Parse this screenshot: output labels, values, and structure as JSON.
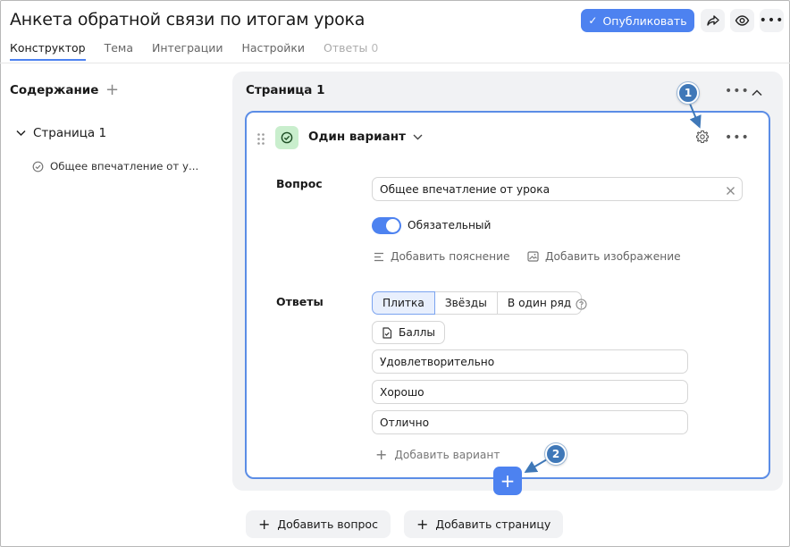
{
  "header": {
    "title": "Анкета обратной связи по итогам урока",
    "publish_label": "Опубликовать",
    "share_icon": "share-icon",
    "preview_icon": "eye-icon",
    "more_icon": "more-icon"
  },
  "tabs": [
    {
      "label": "Конструктор",
      "active": true
    },
    {
      "label": "Тема"
    },
    {
      "label": "Интеграции"
    },
    {
      "label": "Настройки"
    },
    {
      "label": "Ответы",
      "count": "0",
      "disabled": true
    }
  ],
  "sidebar": {
    "title": "Содержание",
    "page_label": "Страница 1",
    "question_label": "Общее впечатление от у..."
  },
  "page": {
    "title": "Страница 1"
  },
  "question": {
    "type_label": "Один вариант",
    "question_label": "Вопрос",
    "question_value": "Общее впечатление от урока",
    "required_label": "Обязательный",
    "add_hint_label": "Добавить пояснение",
    "add_image_label": "Добавить изображение",
    "answers_label": "Ответы",
    "view_options": [
      "Плитка",
      "Звёзды",
      "В один ряд"
    ],
    "selected_view": "Плитка",
    "points_label": "Баллы",
    "answers": [
      "Удовлетворительно",
      "Хорошо",
      "Отлично"
    ],
    "add_variant_label": "Добавить вариант"
  },
  "bottom": {
    "add_question_label": "Добавить вопрос",
    "add_page_label": "Добавить страницу"
  },
  "callouts": [
    "1",
    "2"
  ],
  "colors": {
    "accent": "#4d82f0",
    "callout": "#3f78b8",
    "type_badge": "#c9eecd"
  }
}
